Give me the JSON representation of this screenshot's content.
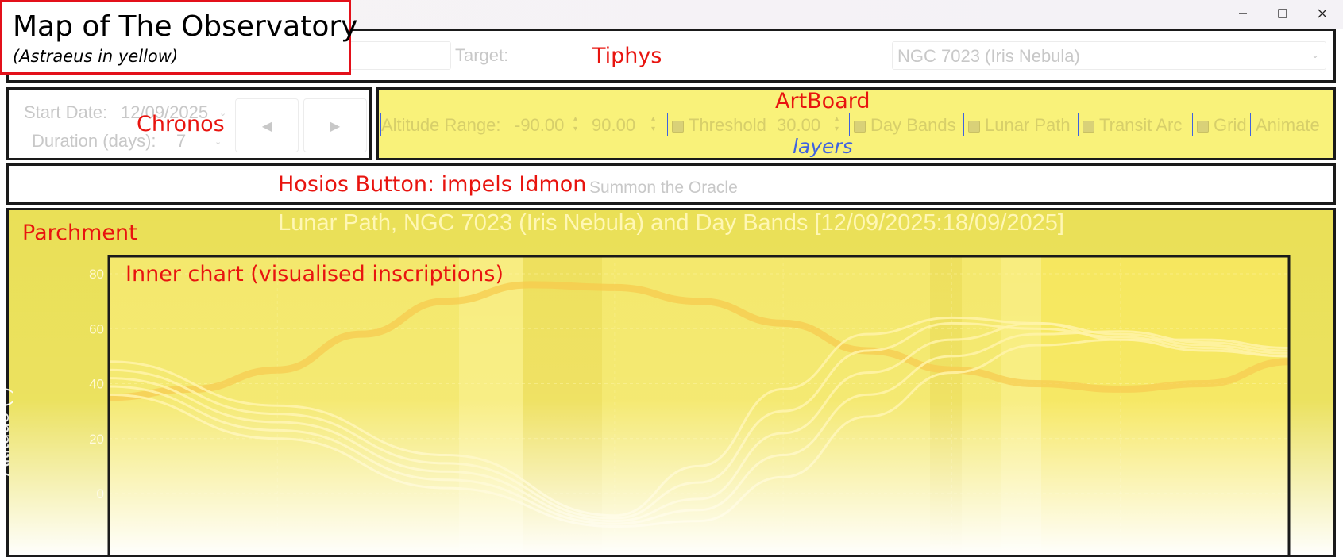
{
  "window": {
    "minimize_icon": "minimize-icon",
    "maximize_icon": "maximize-icon",
    "close_icon": "close-icon"
  },
  "header": {
    "title": "Map of The Observatory",
    "subtitle": "(Astraeus in yellow)"
  },
  "tiphys": {
    "annotation": "Tiphys",
    "target_label": "Target:",
    "target_value": "NGC 7023 (Iris Nebula)"
  },
  "chronos": {
    "annotation": "Chronos",
    "start_date_label": "Start Date:",
    "start_date_value": "12/09/2025",
    "duration_label": "Duration (days):",
    "duration_value": "7",
    "prev_icon": "triangle-left-icon",
    "next_icon": "triangle-right-icon"
  },
  "artboard": {
    "annotation": "ArtBoard",
    "layers_annotation": "layers",
    "altitude_label": "Altitude Range:",
    "altitude_min": "-90.00",
    "altitude_max": "90.00",
    "threshold_label": "Threshold",
    "threshold_value": "30.00",
    "day_bands_label": "Day Bands",
    "lunar_path_label": "Lunar Path",
    "transit_arc_label": "Transit Arc",
    "grid_label": "Grid",
    "animate_label": "Animate"
  },
  "hosios": {
    "annotation": "Hosios Button: impels Idmon",
    "button_label": "Summon the Oracle"
  },
  "parchment": {
    "annotation": "Parchment",
    "inner_annotation": "Inner chart (visualised inscriptions)",
    "chart_title": "Lunar Path, NGC 7023 (Iris Nebula) and Day Bands [12/09/2025:18/09/2025]",
    "y_axis_label": "Altitude (°)"
  },
  "colors": {
    "annotation_red": "#e8140f",
    "frame_black": "#1a1a1a",
    "layer_blue": "#3f62e0",
    "astraeus_yellow": "#f3e65c",
    "lunar_orange": "#f7c94a"
  },
  "chart_data": {
    "type": "line",
    "title": "Lunar Path, NGC 7023 (Iris Nebula) and Day Bands [12/09/2025:18/09/2025]",
    "ylabel": "Altitude (°)",
    "yticks": [
      0,
      20,
      40,
      60,
      80
    ],
    "ylim": [
      -5,
      90
    ],
    "xlim": [
      0,
      7
    ],
    "series": [
      {
        "x": [
          0,
          0.5,
          1,
          1.5,
          2,
          2.5,
          3,
          3.5,
          4,
          4.5,
          5,
          5.5,
          6,
          6.5,
          7
        ],
        "y": [
          35,
          38,
          45,
          58,
          70,
          76,
          75,
          70,
          62,
          52,
          45,
          40,
          38,
          40,
          48
        ]
      },
      {
        "x": [
          0,
          1,
          2,
          3,
          3.5,
          4,
          4.5,
          5,
          5.5,
          6,
          6.5,
          7
        ],
        "y": [
          48,
          32,
          14,
          -8,
          10,
          38,
          58,
          64,
          62,
          56,
          52,
          50
        ]
      },
      {
        "x": [
          0,
          1,
          2,
          3,
          3.5,
          4,
          4.5,
          5,
          5.5,
          6,
          6.5,
          7
        ],
        "y": [
          45,
          29,
          11,
          -9,
          4,
          30,
          52,
          62,
          60,
          57,
          53,
          50
        ]
      },
      {
        "x": [
          0,
          1,
          2,
          3,
          3.5,
          4,
          4.5,
          5,
          5.5,
          6,
          6.5,
          7
        ],
        "y": [
          42,
          26,
          8,
          -10,
          -2,
          22,
          44,
          56,
          62,
          58,
          54,
          51
        ]
      },
      {
        "x": [
          0,
          1,
          2,
          3,
          3.5,
          4,
          4.5,
          5,
          5.5,
          6,
          6.5,
          7
        ],
        "y": [
          39,
          23,
          5,
          -11,
          -6,
          14,
          36,
          50,
          58,
          59,
          55,
          52
        ]
      },
      {
        "x": [
          0,
          1,
          2,
          3,
          3.5,
          4,
          4.5,
          5,
          5.5,
          6,
          6.5,
          7
        ],
        "y": [
          36,
          20,
          2,
          -12,
          -10,
          6,
          28,
          44,
          54,
          56,
          56,
          53
        ]
      }
    ]
  }
}
